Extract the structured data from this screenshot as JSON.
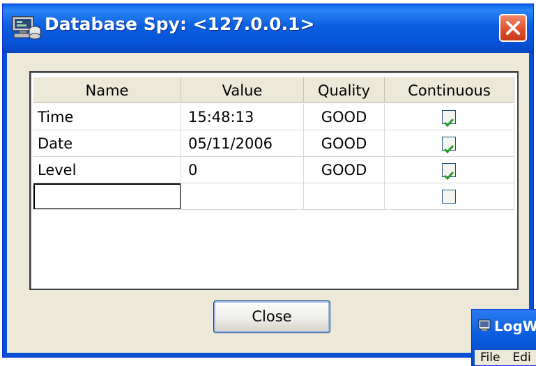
{
  "window": {
    "title": "Database Spy: <127.0.0.1>",
    "close_button_label": "Close"
  },
  "table": {
    "columns": [
      "Name",
      "Value",
      "Quality",
      "Continuous"
    ],
    "rows": [
      {
        "name": "Time",
        "value": "15:48:13",
        "quality": "GOOD",
        "continuous": true
      },
      {
        "name": "Date",
        "value": "05/11/2006",
        "quality": "GOOD",
        "continuous": true
      },
      {
        "name": "Level",
        "value": "0",
        "quality": "GOOD",
        "continuous": true
      },
      {
        "name": "",
        "value": "",
        "quality": "",
        "continuous": false
      }
    ]
  },
  "background_window": {
    "title": "LogW",
    "menu": [
      "File",
      "Edi"
    ]
  },
  "colors": {
    "titlebar": "#0b5ee0",
    "close_red": "#e0502c",
    "dialog_bg": "#ece9d8",
    "check_green": "#21a121"
  }
}
